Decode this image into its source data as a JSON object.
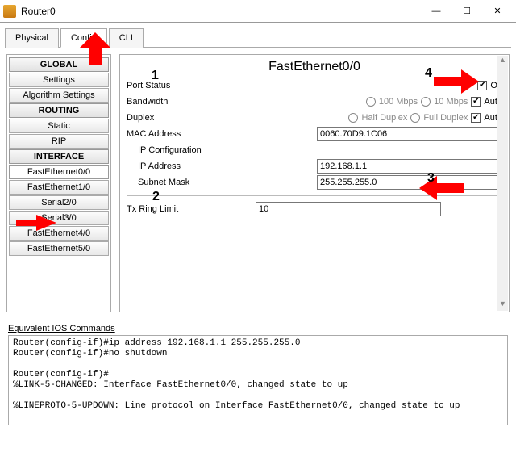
{
  "window": {
    "title": "Router0"
  },
  "tabs": {
    "physical": "Physical",
    "config": "Config",
    "cli": "CLI"
  },
  "sidebar": {
    "global": "GLOBAL",
    "settings": "Settings",
    "algo": "Algorithm Settings",
    "routing": "ROUTING",
    "static": "Static",
    "rip": "RIP",
    "interface": "INTERFACE",
    "items": [
      "FastEthernet0/0",
      "FastEthernet1/0",
      "Serial2/0",
      "Serial3/0",
      "FastEthernet4/0",
      "FastEthernet5/0"
    ]
  },
  "panel": {
    "title": "FastEthernet0/0",
    "port_status": "Port Status",
    "on": "On",
    "bandwidth": "Bandwidth",
    "bw100": "100 Mbps",
    "bw10": "10 Mbps",
    "auto": "Auto",
    "duplex": "Duplex",
    "half": "Half Duplex",
    "full": "Full Duplex",
    "mac": "MAC Address",
    "mac_val": "0060.70D9.1C06",
    "ipconf": "IP Configuration",
    "ip": "IP Address",
    "ip_val": "192.168.1.1",
    "mask": "Subnet Mask",
    "mask_val": "255.255.255.0",
    "txring": "Tx Ring Limit",
    "txring_val": "10"
  },
  "cmds": {
    "caption": "Equivalent IOS Commands",
    "text": "Router(config-if)#ip address 192.168.1.1 255.255.255.0\nRouter(config-if)#no shutdown\n\nRouter(config-if)#\n%LINK-5-CHANGED: Interface FastEthernet0/0, changed state to up\n\n%LINEPROTO-5-UPDOWN: Line protocol on Interface FastEthernet0/0, changed state to up"
  },
  "markers": {
    "n1": "1",
    "n2": "2",
    "n3": "3",
    "n4": "4"
  }
}
